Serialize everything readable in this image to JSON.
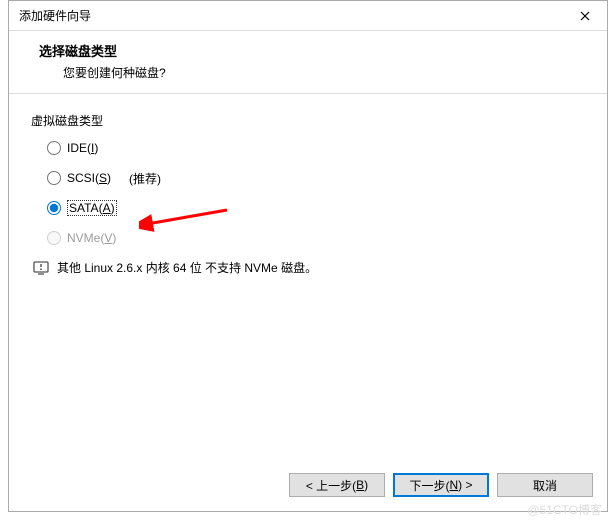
{
  "titlebar": {
    "title": "添加硬件向导"
  },
  "header": {
    "title": "选择磁盘类型",
    "subtitle": "您要创建何种磁盘?"
  },
  "group": {
    "label": "虚拟磁盘类型"
  },
  "options": {
    "ide": {
      "text": "IDE",
      "key": "I"
    },
    "scsi": {
      "text": "SCSI",
      "key": "S",
      "recommend": "(推荐)"
    },
    "sata": {
      "text": "SATA",
      "key": "A"
    },
    "nvme": {
      "text": "NVMe",
      "key": "V"
    }
  },
  "info": {
    "text": "其他 Linux 2.6.x 内核 64 位 不支持 NVMe 磁盘。"
  },
  "buttons": {
    "back": {
      "prefix": "< 上一步(",
      "key": "B",
      "suffix": ")"
    },
    "next": {
      "prefix": "下一步(",
      "key": "N",
      "suffix": ") >"
    },
    "cancel": {
      "label": "取消"
    }
  },
  "watermark": "@51CTO博客"
}
